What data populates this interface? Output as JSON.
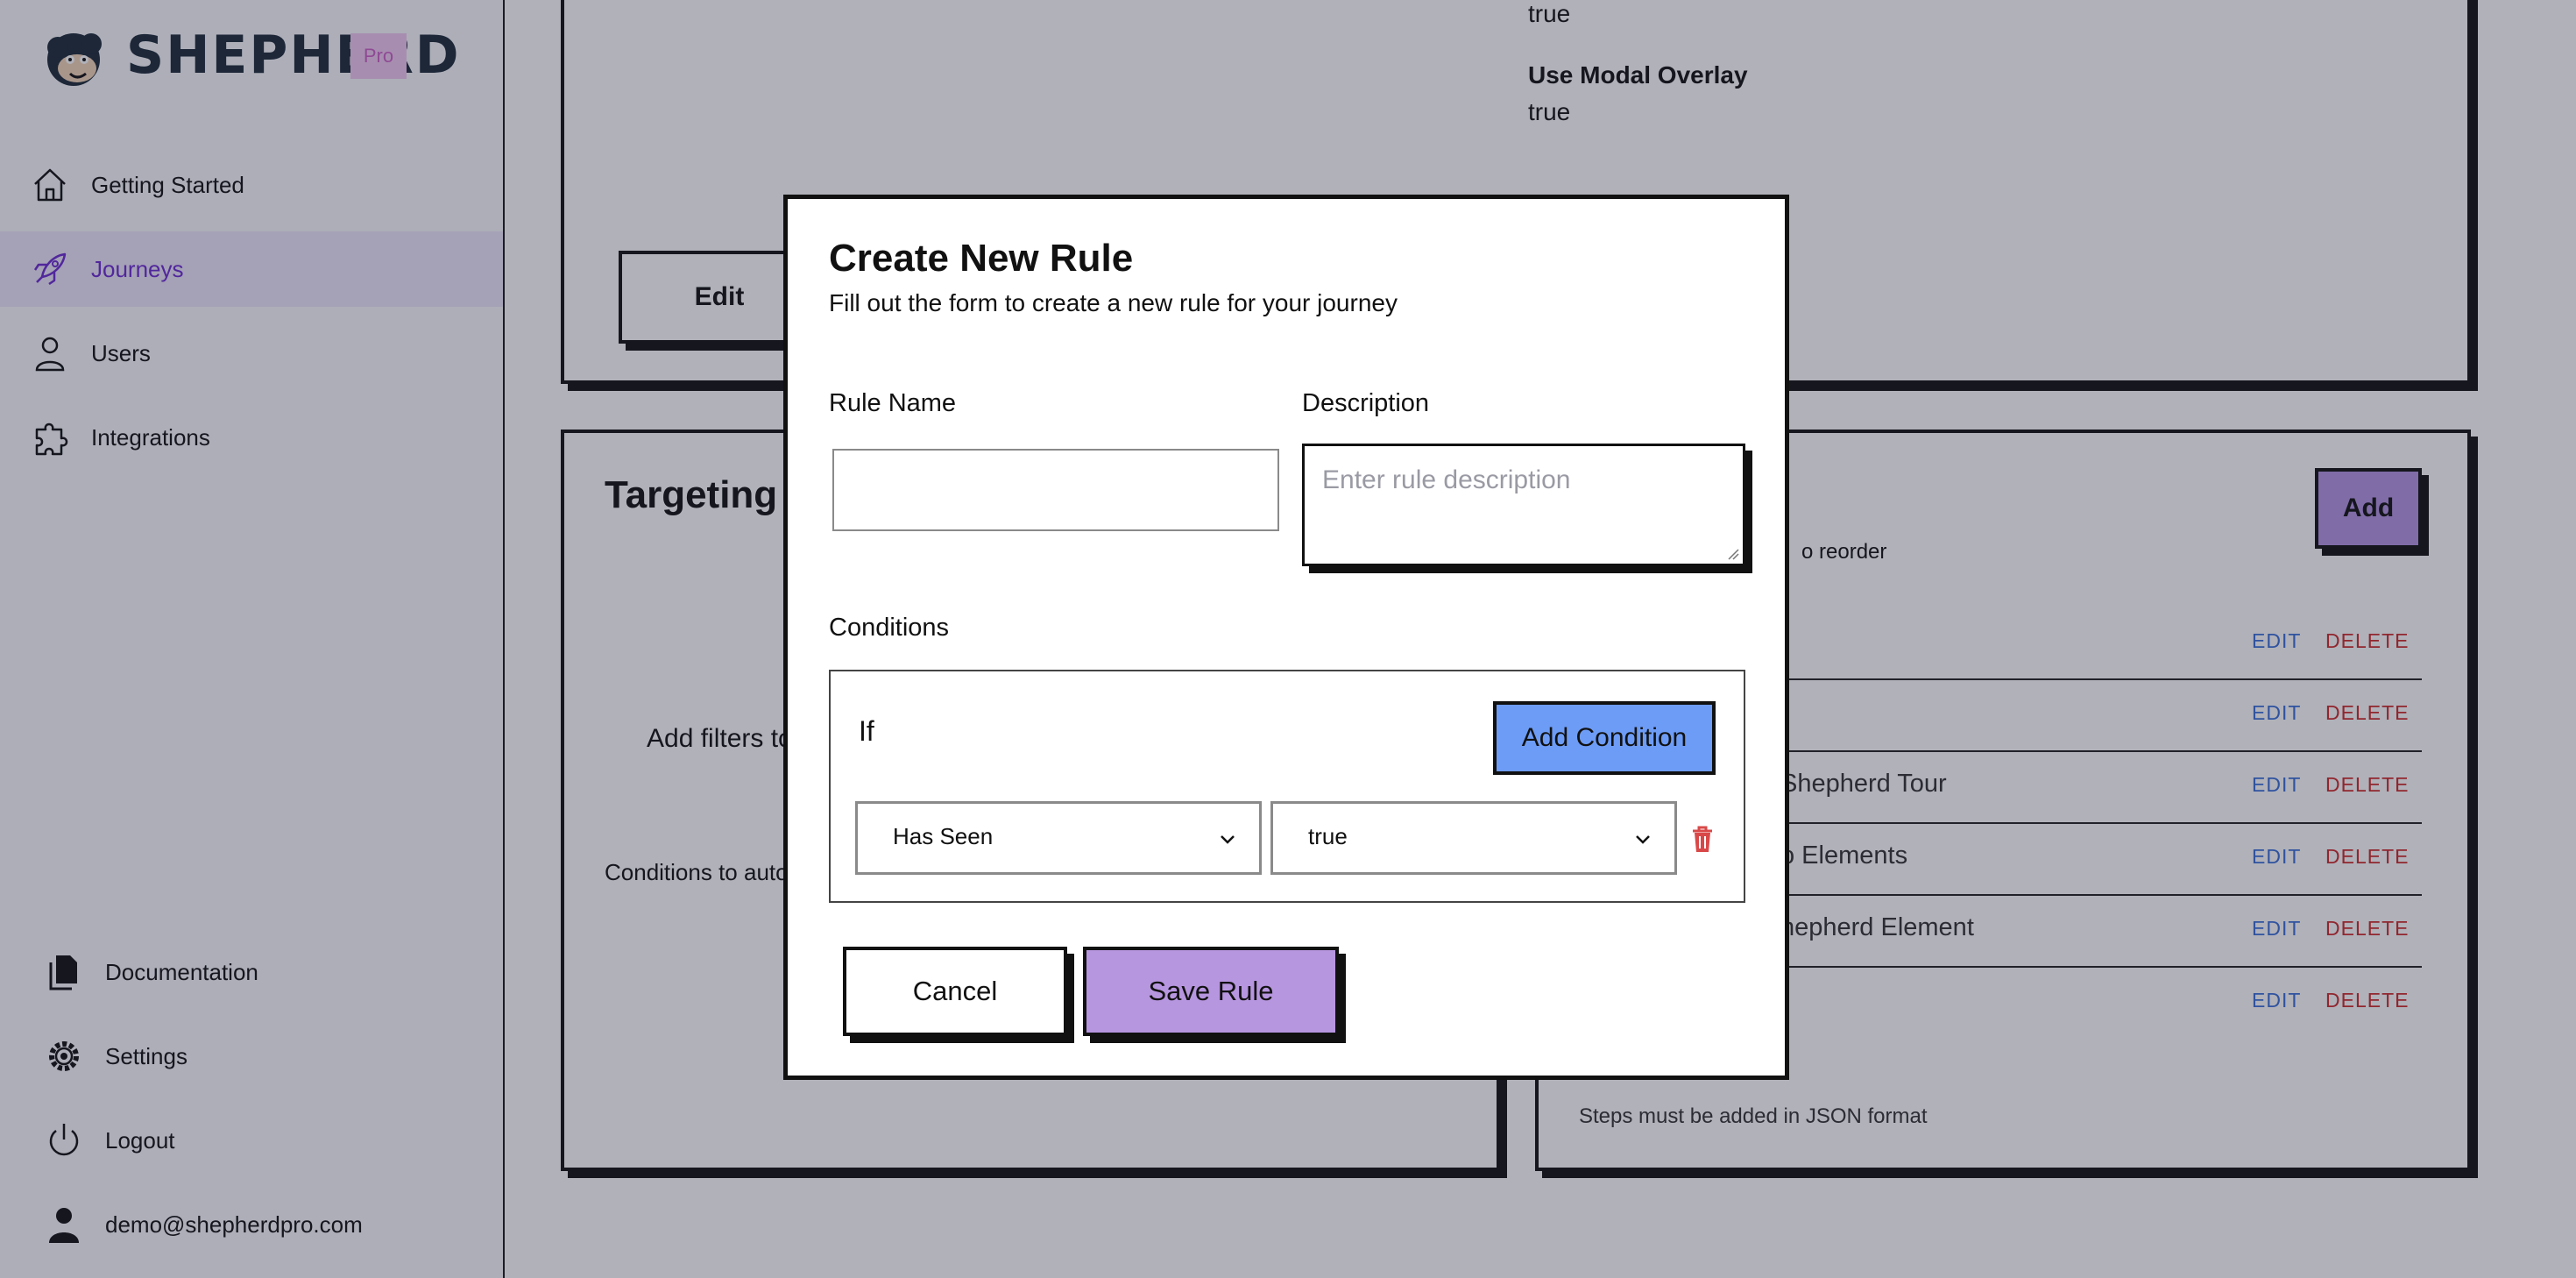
{
  "brand": {
    "name": "SHEPHERD",
    "badge": "Pro"
  },
  "sidebar": {
    "items": [
      {
        "label": "Getting Started",
        "icon": "home-icon"
      },
      {
        "label": "Journeys",
        "icon": "rocket-icon",
        "active": true
      },
      {
        "label": "Users",
        "icon": "user-icon"
      },
      {
        "label": "Integrations",
        "icon": "puzzle-icon"
      }
    ],
    "bottom_items": [
      {
        "label": "Documentation",
        "icon": "documents-icon"
      },
      {
        "label": "Settings",
        "icon": "gear-icon"
      },
      {
        "label": "Logout",
        "icon": "power-icon"
      },
      {
        "label": "demo@shepherdpro.com",
        "icon": "account-icon"
      }
    ]
  },
  "background": {
    "options_card": {
      "value_top": "true",
      "modal_overlay_label": "Use Modal Overlay",
      "modal_overlay_value": "true",
      "edit_button": "Edit"
    },
    "targeting_card": {
      "title": "Targeting",
      "filters_text": "Add filters to",
      "conditions_text": "Conditions to auto"
    },
    "steps_card": {
      "add_button": "Add",
      "reorder_text": "o reorder",
      "footer": "Steps must be added in JSON format",
      "edit_label": "EDIT",
      "delete_label": "DELETE",
      "rows": [
        "",
        "",
        "Shepherd Tour",
        "o Elements",
        "hepherd Element",
        ""
      ]
    }
  },
  "modal": {
    "title": "Create New Rule",
    "subtitle": "Fill out the form to create a new rule for your journey",
    "rule_name_label": "Rule Name",
    "rule_name_value": "",
    "description_label": "Description",
    "description_placeholder": "Enter rule description",
    "conditions_label": "Conditions",
    "if_label": "If",
    "add_condition_button": "Add Condition",
    "condition_field": "Has Seen",
    "condition_value": "true",
    "cancel_button": "Cancel",
    "save_button": "Save Rule"
  },
  "colors": {
    "accent_purple": "#b796e0",
    "active_nav_text": "#6d2bd3",
    "add_condition_blue": "#6d9cf6",
    "edit_blue": "#3b6fd8",
    "delete_red": "#d02a2a"
  }
}
